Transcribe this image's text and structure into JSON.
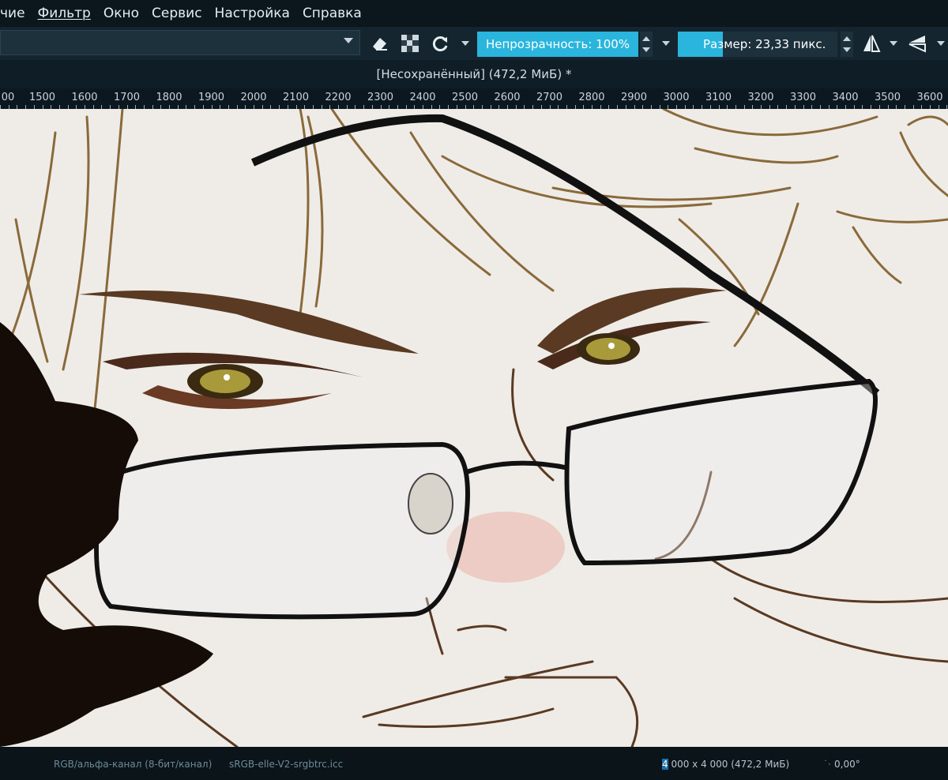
{
  "menu": [
    {
      "label": "чие"
    },
    {
      "label": "Фильтр",
      "mnemonic": "Ф"
    },
    {
      "label": "Окно",
      "mnemonic": "О"
    },
    {
      "label": "Сервис",
      "mnemonic": "е"
    },
    {
      "label": "Настройка",
      "mnemonic": "Н"
    },
    {
      "label": "Справка",
      "mnemonic": "С"
    }
  ],
  "toolbar": {
    "opacity_label": "Непрозрачность: 100%",
    "size_label": "Размер: 23,33 пикс.",
    "size_fill_fraction": 0.28
  },
  "document": {
    "title": "[Несохранённый]  (472,2 МиБ) *"
  },
  "ruler": {
    "labels": [
      "00",
      "1500",
      "1600",
      "1700",
      "1800",
      "1900",
      "2000",
      "2100",
      "2200",
      "2300",
      "2400",
      "2500",
      "2600",
      "2700",
      "2800",
      "2900",
      "3000",
      "3100",
      "3200",
      "3300",
      "3400",
      "3500",
      "3600"
    ]
  },
  "status": {
    "color_model": "RGB/альфа-канал (8-бит/канал)",
    "profile": "sRGB-elle-V2-srgbtrc.icc",
    "dims_first": "4",
    "dims_rest": " 000 x 4 000 (472,2 МиБ)",
    "rotation": "0,00°"
  },
  "colors": {
    "accent": "#2ab5dd",
    "toolbar_bg": "#14252f",
    "canvas_bg": "#efece8"
  }
}
